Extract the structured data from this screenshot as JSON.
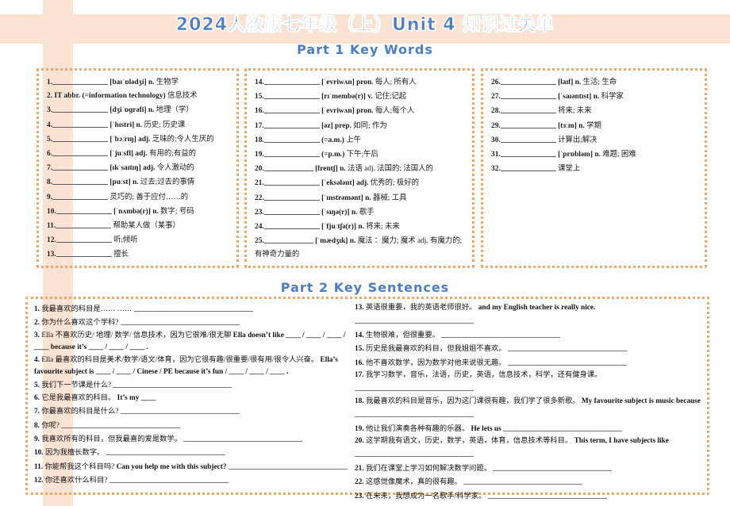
{
  "title": "2024人教版七年级（上）Unit 4 知识过关单",
  "part1": {
    "heading": "Part 1 Key  Words",
    "columns": [
      {
        "name": "words-column-1",
        "entries": [
          {
            "num": "1.",
            "blank": "__________",
            "phonetic": "[baɪˈɒlədʒi]",
            "pos": "n.",
            "cn": "生物学"
          },
          {
            "num": "2.",
            "blank": "",
            "phonetic": "IT abbr. (=information technology)",
            "pos": "",
            "cn": "信息技术",
            "noblank": true
          },
          {
            "num": "3.",
            "blank": "__________",
            "phonetic": "[dʒiˈɒɡrəfi]",
            "pos": "n.",
            "cn": "地理（学）"
          },
          {
            "num": "4.",
            "blank": "__________",
            "phonetic": "[ˈhɪstri]",
            "pos": "n.",
            "cn": "历史; 历史课"
          },
          {
            "num": "5.",
            "blank": "__________",
            "phonetic": "[ˈbɔːrɪŋ]",
            "pos": "adj.",
            "cn": "乏味的;令人生厌的"
          },
          {
            "num": "6.",
            "blank": "__________",
            "phonetic": "[ˈjuːsfl]",
            "pos": "adj.",
            "cn": "有用的;有益的"
          },
          {
            "num": "7.",
            "blank": "__________",
            "phonetic": "[ɪkˈsaɪtɪŋ]",
            "pos": "adj.",
            "cn": "令人激动的"
          },
          {
            "num": "8.",
            "blank": "__________",
            "phonetic": "[pɑːst]",
            "pos": "n.",
            "cn": "过去;过去的事情"
          },
          {
            "num": "9.",
            "blank": "__________",
            "phonetic": "",
            "pos": "",
            "cn": "灵巧的; 善于应付……的"
          },
          {
            "num": "10.",
            "blank": "__________",
            "phonetic": "[ˈnʌmbə(r)]",
            "pos": "n.",
            "cn": "数字; 号码"
          },
          {
            "num": "11.",
            "blank": "__________",
            "phonetic": "",
            "pos": "",
            "cn": "帮助某人做（某事）"
          },
          {
            "num": "12.",
            "blank": "__________",
            "phonetic": "",
            "pos": "",
            "cn": "听;倾听"
          },
          {
            "num": "13.",
            "blank": "__________",
            "phonetic": "",
            "pos": "",
            "cn": "擅长"
          }
        ]
      },
      {
        "name": "words-column-2",
        "entries": [
          {
            "num": "14.",
            "blank": "__________",
            "phonetic": "[ˈevriwʌn]",
            "pos": "pron.",
            "cn": "每人; 所有人"
          },
          {
            "num": "15.",
            "blank": "__________",
            "phonetic": "[rɪˈmembə(r)]",
            "pos": "v.",
            "cn": "记住;记起"
          },
          {
            "num": "16.",
            "blank": "__________",
            "phonetic": "[ˈevriwʌn]",
            "pos": "pron.",
            "cn": "每人;每个人"
          },
          {
            "num": "17.",
            "blank": "__________",
            "phonetic": "[əz]",
            "pos": "prep.",
            "cn": "如同; 作为"
          },
          {
            "num": "18.",
            "blank": "__________",
            "phonetic": "(=a.m.)",
            "pos": "",
            "cn": "上午"
          },
          {
            "num": "19.",
            "blank": "__________",
            "phonetic": "(=p.m.)",
            "pos": "",
            "cn": "下午;午后"
          },
          {
            "num": "20.",
            "blank": "__________",
            "phonetic": "[frentʃ]",
            "pos": "n.",
            "cn": "法语 adj. 法国的; 法国人的"
          },
          {
            "num": "21.",
            "blank": "__________",
            "phonetic": "[ˈeksələnt]",
            "pos": "adj.",
            "cn": "优秀的; 极好的"
          },
          {
            "num": "22.",
            "blank": "__________",
            "phonetic": "[ˈɪnstrəmənt]",
            "pos": "n.",
            "cn": "器械; 工具"
          },
          {
            "num": "23.",
            "blank": "__________",
            "phonetic": "[ˈsɪŋə(r)]",
            "pos": "n.",
            "cn": "歌手"
          },
          {
            "num": "24.",
            "blank": "__________",
            "phonetic": "[ˈfjuːtʃə(r)]",
            "pos": "n.",
            "cn": "将来; 未来"
          },
          {
            "num": "25.",
            "blank": "__________",
            "phonetic": "[ˈmædʒɪk]",
            "pos": "n.",
            "cn": "魔法 ：魔力; 魔术 adj. 有魔力的;有神奇力量的",
            "wrap": true
          }
        ]
      },
      {
        "name": "words-column-3",
        "entries": [
          {
            "num": "26.",
            "blank": "__________",
            "phonetic": "[laɪf]",
            "pos": "n.",
            "cn": "生活; 生命"
          },
          {
            "num": "27.",
            "blank": "__________",
            "phonetic": "[ˈsaɪəntɪst]",
            "pos": "n.",
            "cn": "科学家"
          },
          {
            "num": "28.",
            "blank": "__________",
            "phonetic": "",
            "pos": "",
            "cn": "将来; 未来"
          },
          {
            "num": "29.",
            "blank": "__________",
            "phonetic": "[tɜːm]",
            "pos": "n.",
            "cn": "学期"
          },
          {
            "num": "30.",
            "blank": "__________",
            "phonetic": "",
            "pos": "",
            "cn": "计算出;解决"
          },
          {
            "num": "31.",
            "blank": "__________",
            "phonetic": "[ˈprɒbləm]",
            "pos": "n.",
            "cn": "难题; 困难"
          },
          {
            "num": "32.",
            "blank": "__________",
            "phonetic": "",
            "pos": "",
            "cn": "课堂上"
          }
        ]
      }
    ]
  },
  "part2": {
    "heading": "Part 2 Key Sentences",
    "left": [
      {
        "num": "1.",
        "cn": "我最喜欢的科目是……",
        "en": "",
        "tail": "……"
      },
      {
        "num": "2.",
        "cn": "你为什么喜欢这个学科?",
        "en": ""
      },
      {
        "num": "3.",
        "cn": "Ella 不喜欢历史/ 地理/ 数学/ 信息技术，因为它很难/很无聊",
        "en": "Ella doesn’t like ____ / ____ / ____ / ____ because it’s ____ / ____ / ____ ."
      },
      {
        "num": "4.",
        "cn": "Ella 最喜欢的科目是美术/数学/语文/体育，因为它很有趣/很重要/很有用/很令人兴奋。",
        "en": "Ella’s favourite subject is ____ / ____ / Cinese / PE because it’s fun / ____ / ____ / ____ ."
      },
      {
        "num": "5.",
        "cn": "我们下一节课是什么?",
        "en": ""
      },
      {
        "num": "6.",
        "cn": "它是我最喜欢的科目。",
        "en": "It’s my ____"
      },
      {
        "num": "7.",
        "cn": "你最喜欢的科目是什么?",
        "en": ""
      },
      {
        "num": "8.",
        "cn": "你呢?",
        "en": ""
      },
      {
        "num": "9.",
        "cn": "我喜欢所有的科目，但我最喜的爱是数学。",
        "en": ""
      },
      {
        "num": "10.",
        "cn": "因为我擅长数字。",
        "en": ""
      },
      {
        "num": "11.",
        "cn": "你能帮我这个科目吗?",
        "en": "Can you help me with this subject?"
      },
      {
        "num": "12.",
        "cn": "你还喜欢什么科目?",
        "en": ""
      }
    ],
    "right": [
      {
        "num": "13.",
        "cn": "英语很重要，我的英语老师很好。",
        "en": "and my English teacher is really nice."
      },
      {
        "num": "14.",
        "cn": "生物很难，但很重要。",
        "en": ""
      },
      {
        "num": "15.",
        "cn": "历史是我最喜欢的科目，但我姐姐不喜欢。",
        "en": ""
      },
      {
        "num": "16.",
        "cn": "他不喜欢数学，因为数学对他来说很无趣。",
        "en": ""
      },
      {
        "num": "17.",
        "cn": "我学习数学，音乐，法语，历史，英语，信息技术，科学，还有健身课。",
        "en": ""
      },
      {
        "num": "18.",
        "cn": "我最喜欢的科目是音乐，因为这门课很有趣，我们学了很多新歌。",
        "en": "My favourite subject is music because"
      },
      {
        "num": "19.",
        "cn": "他让我们演奏各种有趣的乐器。",
        "en": "He lets us"
      },
      {
        "num": "20.",
        "cn": "这学期我有语文，历史，数学，英语，体育，信息技术等科目。",
        "en": "This term, I have subjects like"
      },
      {
        "num": "21.",
        "cn": "我们在课堂上学习如何解决数学问题。",
        "en": ""
      },
      {
        "num": "22.",
        "cn": "这感觉像魔术，真的很有趣。",
        "en": ""
      },
      {
        "num": "23.",
        "cn": "在未来，我想成为一名歌手/科学家。",
        "en": ""
      }
    ]
  },
  "colors": {
    "band": "#fbe3d4",
    "dots": "#f0a868",
    "title": "#4a7ec8"
  }
}
